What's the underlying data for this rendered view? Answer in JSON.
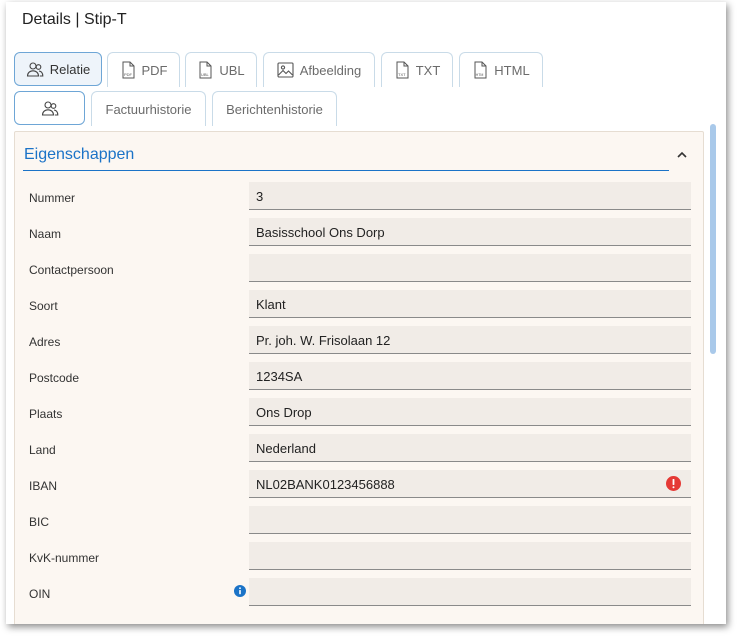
{
  "window": {
    "title": "Details | Stip-T"
  },
  "doc_tabs": [
    {
      "label": "Relatie",
      "icon": "user-group-icon",
      "active": true
    },
    {
      "label": "PDF",
      "icon": "pdf-file-icon"
    },
    {
      "label": "UBL",
      "icon": "ubl-file-icon"
    },
    {
      "label": "Afbeelding",
      "icon": "image-icon"
    },
    {
      "label": "TXT",
      "icon": "txt-file-icon"
    },
    {
      "label": "HTML",
      "icon": "html-file-icon"
    }
  ],
  "sub_tabs": [
    {
      "label": "",
      "icon": "user-group-icon",
      "active": true
    },
    {
      "label": "Factuurhistorie"
    },
    {
      "label": "Berichtenhistorie"
    }
  ],
  "section": {
    "title": "Eigenschappen"
  },
  "fields": [
    {
      "label": "Nummer",
      "value": "3"
    },
    {
      "label": "Naam",
      "value": "Basisschool Ons Dorp"
    },
    {
      "label": "Contactpersoon",
      "value": ""
    },
    {
      "label": "Soort",
      "value": "Klant"
    },
    {
      "label": "Adres",
      "value": "Pr. joh. W. Frisolaan 12"
    },
    {
      "label": "Postcode",
      "value": "1234SA"
    },
    {
      "label": "Plaats",
      "value": "Ons Drop"
    },
    {
      "label": "Land",
      "value": "Nederland"
    },
    {
      "label": "IBAN",
      "value": "NL02BANK0123456888"
    },
    {
      "label": "BIC",
      "value": ""
    },
    {
      "label": "KvK-nummer",
      "value": ""
    },
    {
      "label": "OIN",
      "value": ""
    }
  ],
  "colors": {
    "accent": "#1b73c7",
    "error": "#e53935",
    "panel_bg": "#fcf7f2"
  }
}
